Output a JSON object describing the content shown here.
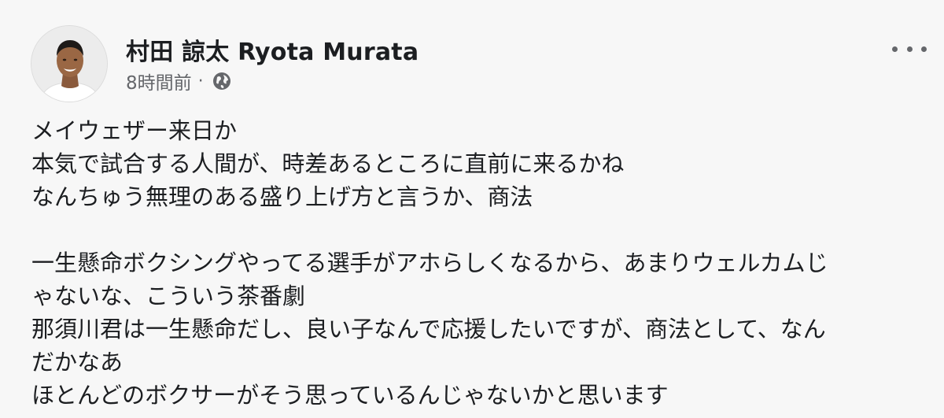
{
  "post": {
    "author_name": "村田 諒太 Ryota Murata",
    "timestamp": "8時間前",
    "separator": "·",
    "privacy_icon": "globe-icon",
    "menu_icon": "more-options-icon",
    "paragraphs": [
      {
        "lines": [
          "メイウェザー来日か",
          "本気で試合する人間が、時差あるところに直前に来るかね",
          "なんちゅう無理のある盛り上げ方と言うか、商法"
        ]
      },
      {
        "lines": [
          "一生懸命ボクシングやってる選手がアホらしくなるから、あまりウェルカムじ",
          "ゃないな、こういう茶番劇",
          "那須川君は一生懸命だし、良い子なんで応援したいですが、商法として、なん",
          "だかなあ",
          "ほとんどのボクサーがそう思っているんじゃないかと思います"
        ]
      }
    ]
  }
}
